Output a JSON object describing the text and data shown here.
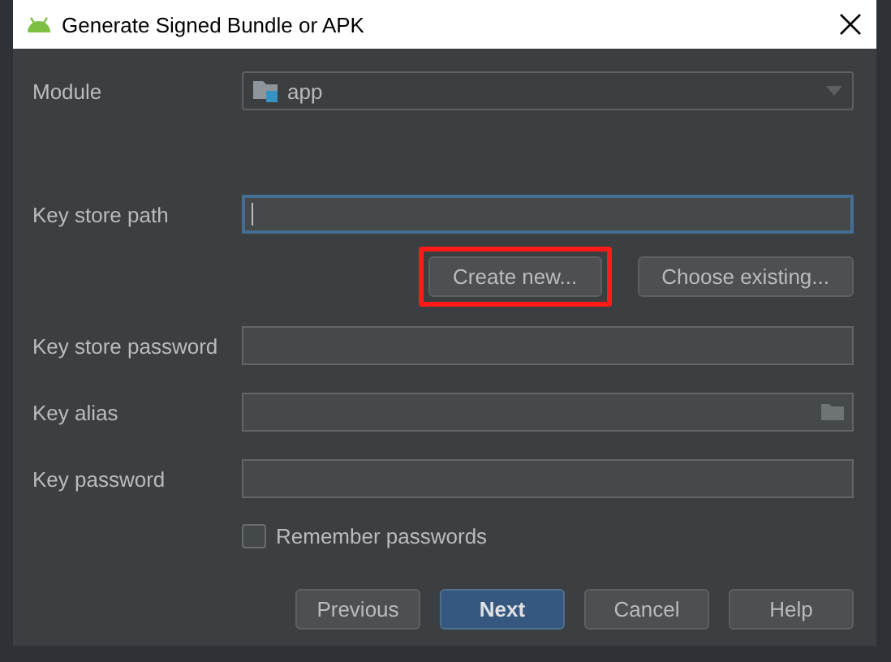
{
  "window": {
    "title": "Generate Signed Bundle or APK"
  },
  "module": {
    "label": "Module",
    "value": "app"
  },
  "key_store_path": {
    "label": "Key store path",
    "focused": true
  },
  "key_store_buttons": [
    {
      "label": "Create new...",
      "highlighted": true
    },
    {
      "label": "Choose existing...",
      "highlighted": false
    }
  ],
  "fields": [
    {
      "label": "Key store password",
      "kind": "text"
    },
    {
      "label": "Key alias",
      "kind": "browse"
    },
    {
      "label": "Key password",
      "kind": "text"
    }
  ],
  "remember_passwords": {
    "label": "Remember passwords",
    "checked": false
  },
  "buttons": [
    {
      "label": "Previous",
      "kind": "normal"
    },
    {
      "label": "Next",
      "kind": "default"
    },
    {
      "label": "Cancel",
      "kind": "normal"
    },
    {
      "label": "Help",
      "kind": "normal"
    }
  ]
}
